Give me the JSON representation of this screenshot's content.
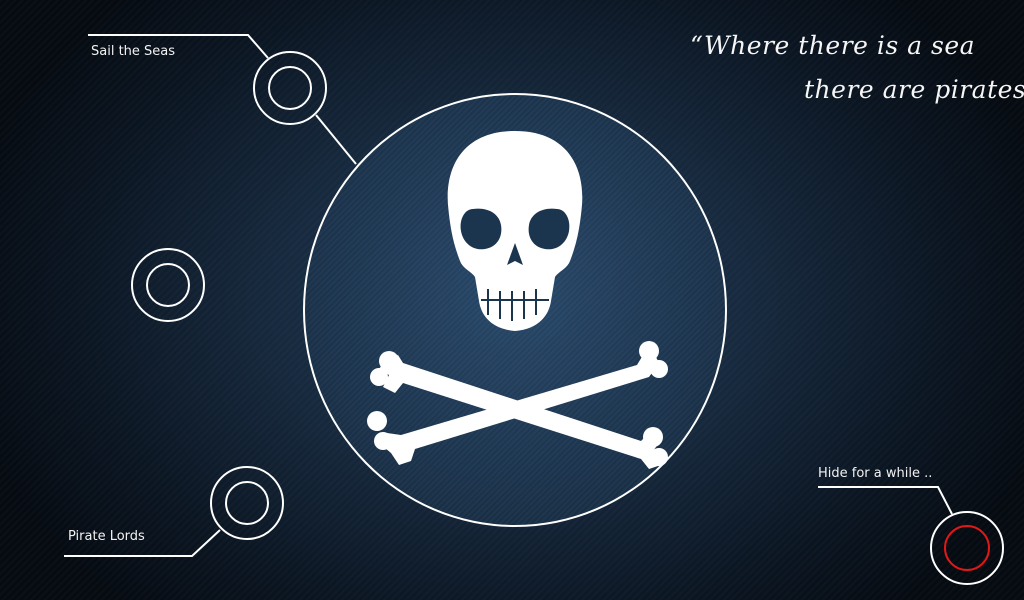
{
  "quote": {
    "line1": "“Where there is a sea",
    "line2": "there are pirates”"
  },
  "nav": {
    "sail": {
      "label": "Sail the Seas",
      "icon": "ring-icon"
    },
    "middle": {
      "label": "",
      "icon": "ring-icon"
    },
    "lords": {
      "label": "Pirate Lords",
      "icon": "ring-icon"
    },
    "hide": {
      "label": "Hide for a while ..",
      "icon": "red-ring-icon"
    }
  },
  "emblem": {
    "icon": "skull-and-crossbones-icon"
  },
  "colors": {
    "background": "#16283c",
    "foreground": "#ffffff",
    "accent_red": "#e01818"
  }
}
